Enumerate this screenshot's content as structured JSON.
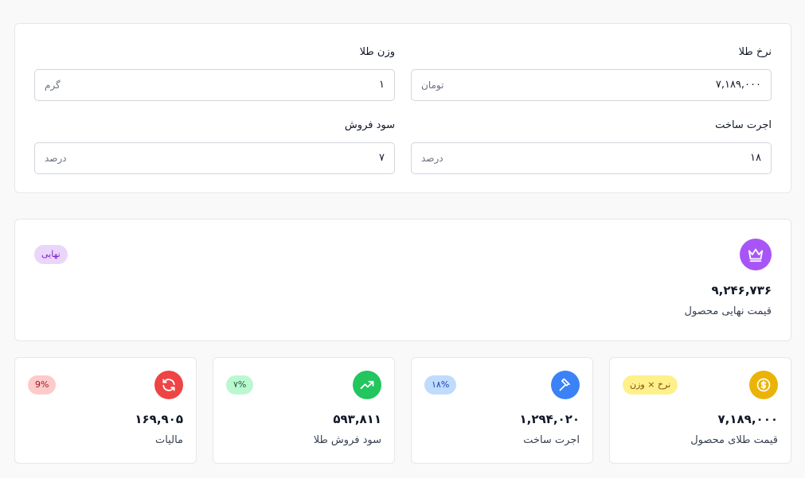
{
  "form": {
    "gold_rate": {
      "label": "نرخ طلا",
      "value": "۷,۱۸۹,۰۰۰",
      "unit": "تومان"
    },
    "gold_weight": {
      "label": "وزن طلا",
      "value": "۱",
      "unit": "گرم"
    },
    "making_fee": {
      "label": "اجرت ساخت",
      "value": "۱۸",
      "unit": "درصد"
    },
    "sale_profit": {
      "label": "سود فروش",
      "value": "۷",
      "unit": "درصد"
    }
  },
  "final": {
    "badge": "نهایی",
    "value": "۹,۲۴۶,۷۳۶",
    "caption": "قیمت نهایی محصول",
    "icon": "crown-icon",
    "color": "#a855f7"
  },
  "stats": [
    {
      "caption": "قیمت طلای محصول",
      "value": "۷,۱۸۹,۰۰۰",
      "badge": "نرخ × وزن",
      "icon": "coin-icon",
      "color": "#eab308",
      "badge_bg": "#fef08a",
      "badge_fg": "#854d0e"
    },
    {
      "caption": "اجرت ساخت",
      "value": "۱,۲۹۴,۰۲۰",
      "badge": "۱۸%",
      "icon": "hammer-icon",
      "color": "#3b82f6",
      "badge_bg": "#bfdbfe",
      "badge_fg": "#1e40af"
    },
    {
      "caption": "سود فروش طلا",
      "value": "۵۹۳,۸۱۱",
      "badge": "۷%",
      "icon": "trending-up-icon",
      "color": "#22c55e",
      "badge_bg": "#bbf7d0",
      "badge_fg": "#166534"
    },
    {
      "caption": "مالیات",
      "value": "۱۶۹,۹۰۵",
      "badge": "9%",
      "icon": "refresh-icon",
      "color": "#ef4444",
      "badge_bg": "#fecaca",
      "badge_fg": "#991b1b"
    }
  ]
}
